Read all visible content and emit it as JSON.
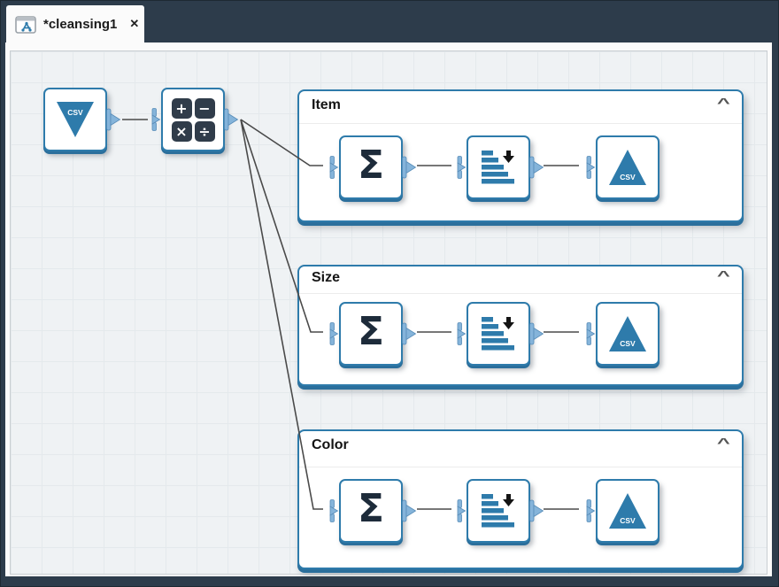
{
  "window": {
    "tab_bar": {
      "active_tab": {
        "title": "*cleansing1",
        "close_glyph": "✕"
      }
    }
  },
  "canvas": {
    "standalone_nodes": {
      "import_csv": {
        "type": "import-csv",
        "badge": "CSV"
      },
      "calculator": {
        "type": "calculator",
        "symbols": [
          "+",
          "−",
          "×",
          "÷"
        ]
      }
    },
    "groups": [
      {
        "title": "Item",
        "collapse_glyph": "^",
        "nodes": [
          {
            "type": "aggregate",
            "glyph": "Σ"
          },
          {
            "type": "sort-descending"
          },
          {
            "type": "export-csv",
            "badge": "CSV"
          }
        ]
      },
      {
        "title": "Size",
        "collapse_glyph": "^",
        "nodes": [
          {
            "type": "aggregate",
            "glyph": "Σ"
          },
          {
            "type": "sort-descending"
          },
          {
            "type": "export-csv",
            "badge": "CSV"
          }
        ]
      },
      {
        "title": "Color",
        "collapse_glyph": "^",
        "nodes": [
          {
            "type": "aggregate",
            "glyph": "Σ"
          },
          {
            "type": "sort-descending"
          },
          {
            "type": "export-csv",
            "badge": "CSV"
          }
        ]
      }
    ],
    "colors": {
      "accent_blue": "#2e7bab",
      "chrome_dark": "#2d3c4b",
      "port_blue": "#85b4da",
      "wire_gray": "#4a4a4a",
      "node_shadow": "#2b6f9c"
    }
  }
}
